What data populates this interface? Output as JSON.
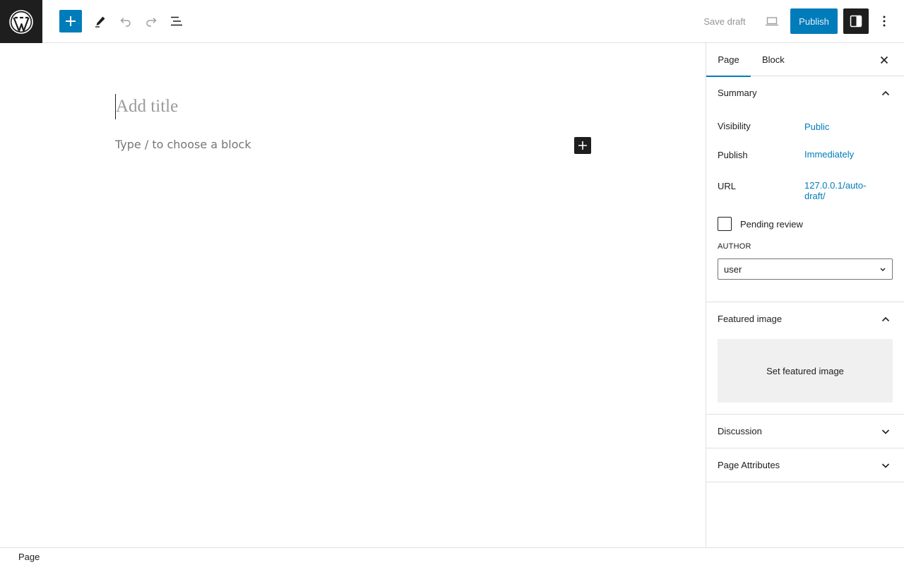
{
  "header": {
    "save_draft_label": "Save draft",
    "publish_label": "Publish"
  },
  "editor": {
    "title_placeholder": "Add title",
    "block_placeholder": "Type / to choose a block"
  },
  "sidebar": {
    "tabs": [
      {
        "label": "Page",
        "active": true
      },
      {
        "label": "Block",
        "active": false
      }
    ],
    "summary": {
      "title": "Summary",
      "expanded": true,
      "visibility_label": "Visibility",
      "visibility_value": "Public",
      "publish_label": "Publish",
      "publish_value": "Immediately",
      "url_label": "URL",
      "url_value_line1": "127.0.0.1/auto-",
      "url_value_line2": "draft/",
      "pending_review_label": "Pending review",
      "pending_review_checked": false,
      "author_label": "AUTHOR",
      "author_value": "user"
    },
    "featured_image": {
      "title": "Featured image",
      "expanded": true,
      "button_label": "Set featured image"
    },
    "discussion": {
      "title": "Discussion",
      "expanded": false
    },
    "page_attributes": {
      "title": "Page Attributes",
      "expanded": false
    }
  },
  "footer": {
    "breadcrumb": "Page"
  },
  "colors": {
    "accent": "#007cba",
    "dark": "#1e1e1e",
    "border": "#e0e0e0"
  },
  "icons": {
    "logo": "wordpress-logo",
    "inserter": "plus-icon",
    "tools": "pencil-icon",
    "undo": "undo-icon",
    "redo": "redo-icon",
    "document_overview": "list-view-icon",
    "preview": "laptop-icon",
    "settings": "sidebar-toggle-icon",
    "options": "more-vertical-icon",
    "close": "close-icon"
  }
}
